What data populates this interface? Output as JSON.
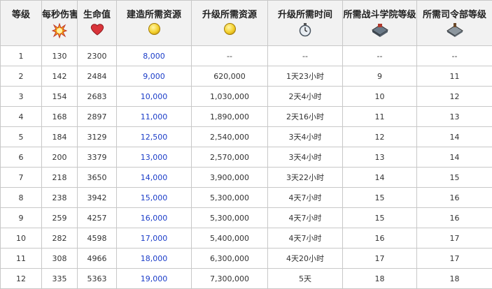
{
  "headers": [
    {
      "label": "等级",
      "icon": ""
    },
    {
      "label": "每秒伤害",
      "icon": "explosion-icon"
    },
    {
      "label": "生命值",
      "icon": "heart-icon"
    },
    {
      "label": "建造所需资源",
      "icon": "gold-coin-icon"
    },
    {
      "label": "升级所需资源",
      "icon": "gold-coin-icon"
    },
    {
      "label": "升级所需时间",
      "icon": "stopwatch-icon"
    },
    {
      "label": "所需战斗学院等级",
      "icon": "battle-academy-icon"
    },
    {
      "label": "所需司令部等级",
      "icon": "headquarters-icon"
    }
  ],
  "cost_color": "#1a3cc8",
  "rows": [
    [
      "1",
      "130",
      "2300",
      "8,000",
      "--",
      "--",
      "--",
      "--"
    ],
    [
      "2",
      "142",
      "2484",
      "9,000",
      "620,000",
      "1天23小时",
      "9",
      "11"
    ],
    [
      "3",
      "154",
      "2683",
      "10,000",
      "1,030,000",
      "2天4小时",
      "10",
      "12"
    ],
    [
      "4",
      "168",
      "2897",
      "11,000",
      "1,890,000",
      "2天16小时",
      "11",
      "13"
    ],
    [
      "5",
      "184",
      "3129",
      "12,500",
      "2,540,000",
      "3天4小时",
      "12",
      "14"
    ],
    [
      "6",
      "200",
      "3379",
      "13,000",
      "2,570,000",
      "3天4小时",
      "13",
      "14"
    ],
    [
      "7",
      "218",
      "3650",
      "14,000",
      "3,900,000",
      "3天22小时",
      "14",
      "15"
    ],
    [
      "8",
      "238",
      "3942",
      "15,000",
      "5,300,000",
      "4天7小时",
      "15",
      "16"
    ],
    [
      "9",
      "259",
      "4257",
      "16,000",
      "5,300,000",
      "4天7小时",
      "15",
      "16"
    ],
    [
      "10",
      "282",
      "4598",
      "17,000",
      "5,400,000",
      "4天7小时",
      "16",
      "17"
    ],
    [
      "11",
      "308",
      "4966",
      "18,000",
      "6,300,000",
      "4天20小时",
      "17",
      "17"
    ],
    [
      "12",
      "335",
      "5363",
      "19,000",
      "7,300,000",
      "5天",
      "18",
      "18"
    ]
  ]
}
